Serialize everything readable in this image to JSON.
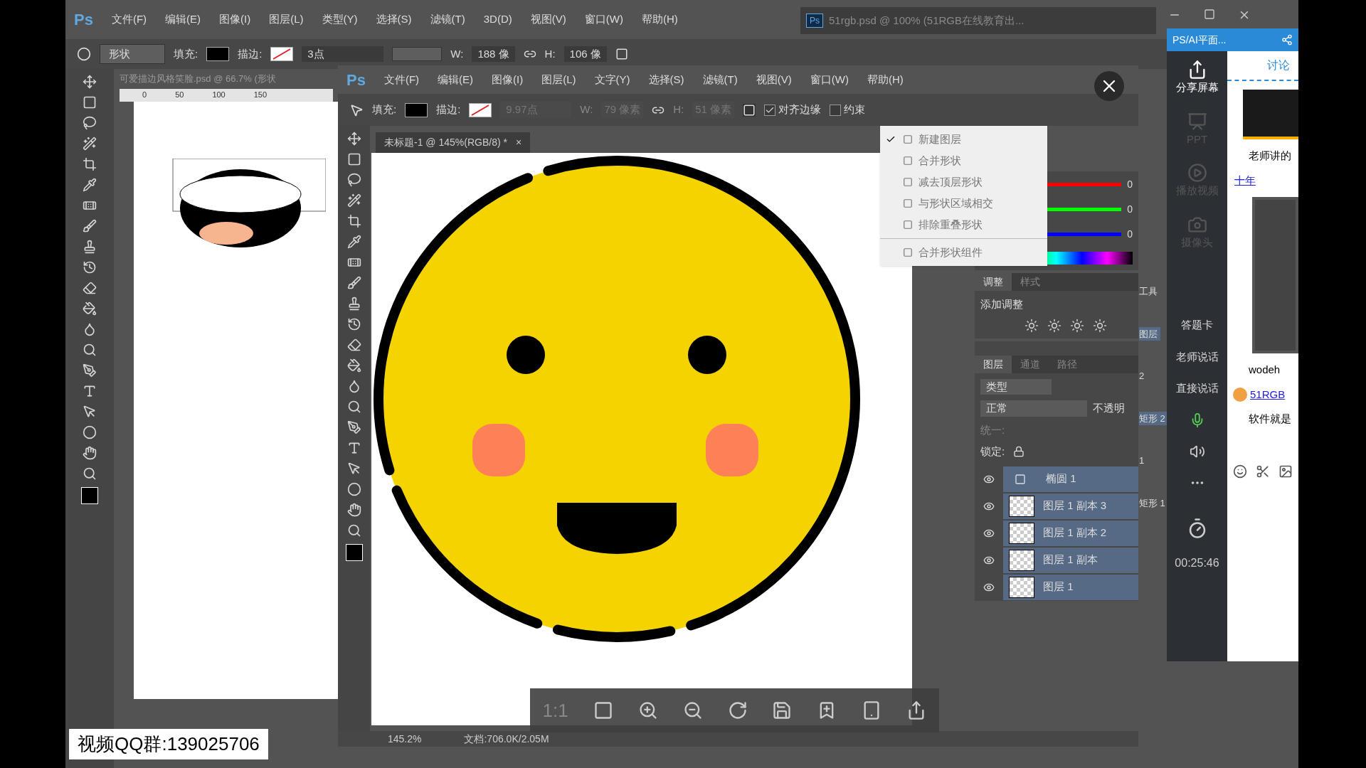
{
  "back_window": {
    "logo": "Ps",
    "menu": [
      "文件(F)",
      "编辑(E)",
      "图像(I)",
      "图层(L)",
      "类型(Y)",
      "选择(S)",
      "滤镜(T)",
      "3D(D)",
      "视图(V)",
      "窗口(W)",
      "帮助(H)"
    ],
    "options": {
      "mode": "形状",
      "fill_label": "填充:",
      "stroke_label": "描边:",
      "stroke_width": "3点",
      "w_label": "W:",
      "w_value": "188 像",
      "h_label": "H:",
      "h_value": "106 像"
    },
    "document_tab": "可爱描边风格笑脸.psd @ 66.7% (形状",
    "ruler_marks": [
      "0",
      "50",
      "100",
      "150"
    ],
    "second_document": {
      "logo": "Ps",
      "title": "51rgb.psd @ 100% (51RGB在线教育出..."
    },
    "side_fragments": [
      {
        "text": "工具",
        "selected": false
      },
      {
        "text": "图层",
        "selected": true
      },
      {
        "text": "2",
        "selected": false
      },
      {
        "text": "矩形 2",
        "selected": true
      },
      {
        "text": "1",
        "selected": false
      },
      {
        "text": "矩形 1",
        "selected": false
      }
    ]
  },
  "front_window": {
    "logo": "Ps",
    "menu": [
      "文件(F)",
      "编辑(E)",
      "图像(I)",
      "图层(L)",
      "文字(Y)",
      "选择(S)",
      "滤镜(T)",
      "视图(V)",
      "窗口(W)",
      "帮助(H)"
    ],
    "options": {
      "fill_label": "填充:",
      "stroke_label": "描边:",
      "stroke_width": "9.97点",
      "w_label": "W:",
      "w_value": "79 像素",
      "h_label": "H:",
      "h_value": "51 像素",
      "checkboxes": [
        {
          "label": "对齐边缘",
          "checked": true
        },
        {
          "label": "约束",
          "checked": false
        }
      ]
    },
    "document_tab": {
      "title": "未标题-1 @ 145%(RGB/8) *",
      "close": "×"
    },
    "status": {
      "zoom": "145.2%",
      "doc": "文档:706.0K/2.05M"
    }
  },
  "path_operations_menu": {
    "items": [
      {
        "label": "新建图层",
        "checked": true
      },
      {
        "label": "合并形状",
        "checked": false
      },
      {
        "label": "减去顶层形状",
        "checked": false
      },
      {
        "label": "与形状区域相交",
        "checked": false
      },
      {
        "label": "排除重叠形状",
        "checked": false
      }
    ],
    "extra_item": "合并形状组件"
  },
  "color_panel": {
    "sliders": [
      {
        "color": "#ff0000",
        "reading": "0"
      },
      {
        "color": "#00ff00",
        "reading": "0"
      },
      {
        "color": "#0000ff",
        "reading": "0"
      }
    ]
  },
  "adjustments_panel": {
    "tabs": [
      {
        "label": "调整",
        "selected": true
      },
      {
        "label": "样式",
        "selected": false
      }
    ],
    "title": "添加调整"
  },
  "layers_panel": {
    "tabs": [
      {
        "label": "图层",
        "selected": true
      },
      {
        "label": "通道",
        "selected": false
      },
      {
        "label": "路径",
        "selected": false
      }
    ],
    "filter": "类型",
    "blend_mode": "正常",
    "opacity_label": "不透明",
    "unify_label": "统一:",
    "lock_label": "锁定:",
    "layers": [
      {
        "name": "椭圆 1",
        "kind": "shape",
        "selected": true,
        "visible": true
      },
      {
        "name": "图层 1 副本 3",
        "kind": "pixel",
        "selected": true,
        "visible": true
      },
      {
        "name": "图层 1 副本 2",
        "kind": "pixel",
        "selected": true,
        "visible": true
      },
      {
        "name": "图层 1 副本",
        "kind": "pixel",
        "selected": true,
        "visible": true
      },
      {
        "name": "图层 1",
        "kind": "pixel",
        "selected": true,
        "visible": true
      }
    ]
  },
  "zoom_bar": {
    "ratio": "1:1"
  },
  "overlay_label": "视频QQ群:139025706",
  "live_app": {
    "title": "PS/AI平面...",
    "tools": [
      {
        "label": "分享屏幕",
        "kind": "share",
        "disabled": false
      },
      {
        "label": "PPT",
        "kind": "ppt",
        "disabled": true
      },
      {
        "label": "播放视频",
        "kind": "video",
        "disabled": true
      },
      {
        "label": "摄像头",
        "kind": "camera",
        "disabled": true
      }
    ],
    "actions": [
      "答题卡",
      "老师说话",
      "直接说话"
    ],
    "timer": "00:25:46",
    "chat": {
      "tab": "讨论",
      "message_1": "老师讲的",
      "link_1": "十年",
      "message_2": "wodeh",
      "sender": "51RGB",
      "message_3": "软件就是"
    }
  }
}
